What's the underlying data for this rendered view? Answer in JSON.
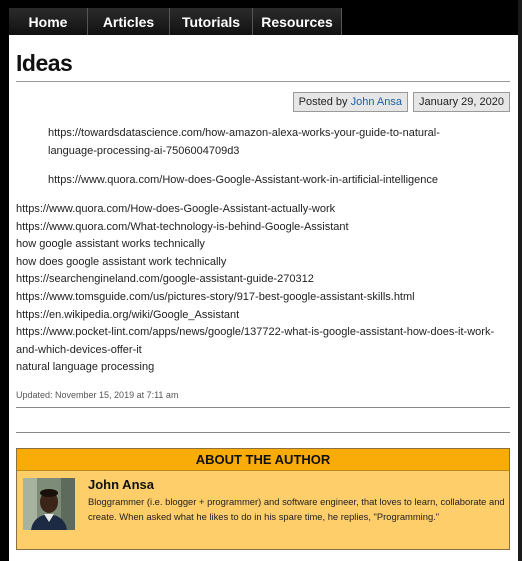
{
  "nav": {
    "items": [
      {
        "label": "Home"
      },
      {
        "label": "Articles"
      },
      {
        "label": "Tutorials"
      },
      {
        "label": "Resources"
      }
    ]
  },
  "post": {
    "title": "Ideas",
    "posted_by_prefix": "Posted by",
    "author_link": "John Ansa",
    "date": "January 29, 2020",
    "quote_lines": [
      "https://towardsdatascience.com/how-amazon-alexa-works-your-guide-to-natural-language-processing-ai-7506004709d3",
      "https://www.quora.com/How-does-Google-Assistant-work-in-artificial-intelligence"
    ],
    "lines": [
      "https://www.quora.com/How-does-Google-Assistant-actually-work",
      "https://www.quora.com/What-technology-is-behind-Google-Assistant",
      "how google assistant works technically",
      "how does google assistant work technically",
      "https://searchengineland.com/google-assistant-guide-270312",
      "https://www.tomsguide.com/us/pictures-story/917-best-google-assistant-skills.html",
      "https://en.wikipedia.org/wiki/Google_Assistant",
      "https://www.pocket-lint.com/apps/news/google/137722-what-is-google-assistant-how-does-it-work-and-which-devices-offer-it",
      "natural language processing"
    ],
    "updated": "Updated: November 15, 2019 at 7:11 am"
  },
  "author_box": {
    "heading": "ABOUT THE AUTHOR",
    "name": "John Ansa",
    "bio": "Bloggrammer (i.e. blogger + programmer) and software engineer, that loves to learn, collaborate and create. When asked what he likes to do in his spare time, he replies, \"Programming.\""
  }
}
